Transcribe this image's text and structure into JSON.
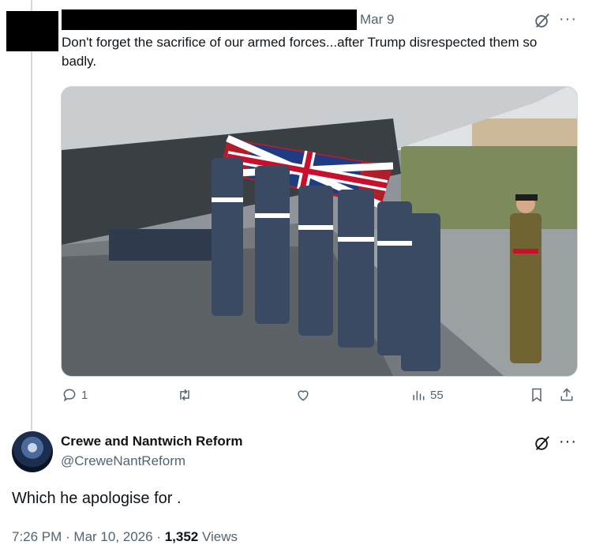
{
  "quoted_tweet": {
    "date": "Mar 9",
    "text": "Don't forget the sacrifice of our armed forces...after Trump disrespected them so badly.",
    "photo_alt_icon": "repatriation-ceremony-photo",
    "actions": {
      "reply_count": "1",
      "retweet_count": "",
      "like_count": "",
      "views_count": "55"
    }
  },
  "reply": {
    "display_name": "Crewe and Nantwich Reform",
    "handle": "@CreweNantReform",
    "text": "Which he apologise for .",
    "time": "7:26 PM · Mar 10, 2026 · ",
    "views_number": "1,352",
    "views_label": " Views"
  },
  "more_glyph": "···",
  "colors": {
    "muted": "#536471",
    "text": "#0f1419",
    "line": "#cfd9de"
  }
}
